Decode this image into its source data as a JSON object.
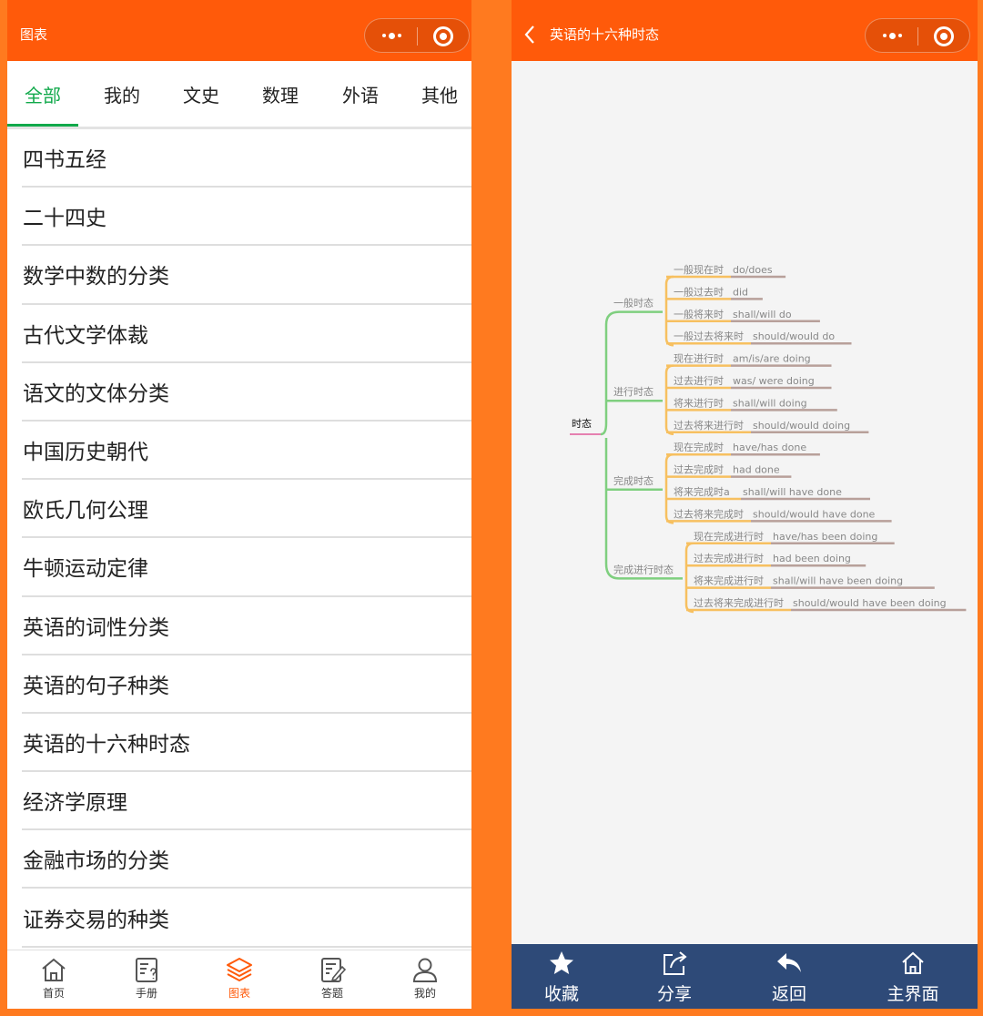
{
  "left": {
    "title": "图表",
    "tabs": [
      {
        "label": "全部",
        "active": true
      },
      {
        "label": "我的",
        "active": false
      },
      {
        "label": "文史",
        "active": false
      },
      {
        "label": "数理",
        "active": false
      },
      {
        "label": "外语",
        "active": false
      },
      {
        "label": "其他",
        "active": false
      }
    ],
    "items": [
      "四书五经",
      "二十四史",
      "数学中数的分类",
      "古代文学体裁",
      "语文的文体分类",
      "中国历史朝代",
      "欧氏几何公理",
      "牛顿运动定律",
      "英语的词性分类",
      "英语的句子种类",
      "英语的十六种时态",
      "经济学原理",
      "金融市场的分类",
      "证券交易的种类"
    ],
    "tabbar": [
      {
        "label": "首页",
        "icon": "home-icon",
        "active": false
      },
      {
        "label": "手册",
        "icon": "handbook-icon",
        "active": false
      },
      {
        "label": "图表",
        "icon": "layers-icon",
        "active": true
      },
      {
        "label": "答题",
        "icon": "edit-icon",
        "active": false
      },
      {
        "label": "我的",
        "icon": "user-icon",
        "active": false
      }
    ]
  },
  "right": {
    "title": "英语的十六种时态",
    "mindmap": {
      "root": "时态",
      "groups": [
        {
          "label": "一般时态",
          "items": [
            {
              "tense": "一般现在时",
              "form": "do/does"
            },
            {
              "tense": "一般过去时",
              "form": "did"
            },
            {
              "tense": "一般将来时",
              "form": "shall/will do"
            },
            {
              "tense": "一般过去将来时",
              "form": "should/would do"
            }
          ]
        },
        {
          "label": "进行时态",
          "items": [
            {
              "tense": "现在进行时",
              "form": "am/is/are doing"
            },
            {
              "tense": "过去进行时",
              "form": "was/ were doing"
            },
            {
              "tense": "将来进行时",
              "form": "shall/will doing"
            },
            {
              "tense": "过去将来进行时",
              "form": "should/would doing"
            }
          ]
        },
        {
          "label": "完成时态",
          "items": [
            {
              "tense": "现在完成时",
              "form": "have/has done"
            },
            {
              "tense": "过去完成时",
              "form": "had done"
            },
            {
              "tense": "将来完成时a",
              "form": "shall/will have done"
            },
            {
              "tense": "过去将来完成时",
              "form": "should/would have done"
            }
          ]
        },
        {
          "label": "完成进行时态",
          "items": [
            {
              "tense": "现在完成进行时",
              "form": "have/has been doing"
            },
            {
              "tense": "过去完成进行时",
              "form": "had been doing"
            },
            {
              "tense": "将来完成进行时",
              "form": "shall/will have been doing"
            },
            {
              "tense": "过去将来完成进行时",
              "form": "should/would have been doing"
            }
          ]
        }
      ],
      "colors": {
        "trunk": "#7fcf7f",
        "branch": "#f7c060",
        "underline": "#b8a09a",
        "root_underline": "#e05a9a"
      }
    },
    "actions": [
      {
        "label": "收藏",
        "icon": "star-icon"
      },
      {
        "label": "分享",
        "icon": "share-icon"
      },
      {
        "label": "返回",
        "icon": "reply-icon"
      },
      {
        "label": "主界面",
        "icon": "home-icon"
      }
    ]
  }
}
